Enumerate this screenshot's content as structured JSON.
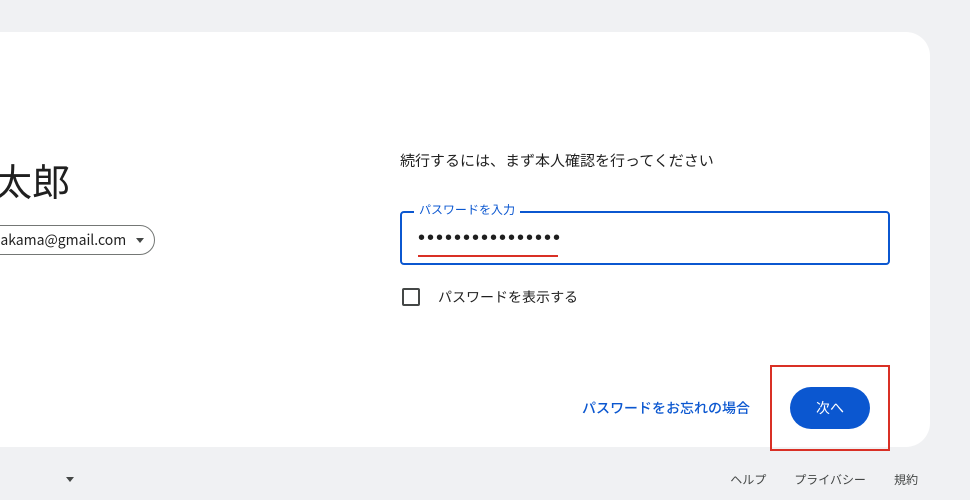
{
  "left": {
    "account_name_partial": "日太郎",
    "account_email_partial": "enonakama@gmail.com"
  },
  "right": {
    "instruction": "続行するには、まず本人確認を行ってください",
    "password_label": "パスワードを入力",
    "password_masked": "••••••••••••••••",
    "show_password_label": "パスワードを表示する",
    "forgot_password": "パスワードをお忘れの場合",
    "next_button": "次へ"
  },
  "footer": {
    "help": "ヘルプ",
    "privacy": "プライバシー",
    "terms": "規約"
  },
  "colors": {
    "primary": "#0b57d0",
    "highlight": "#d93025",
    "bg": "#f0f1f3"
  }
}
